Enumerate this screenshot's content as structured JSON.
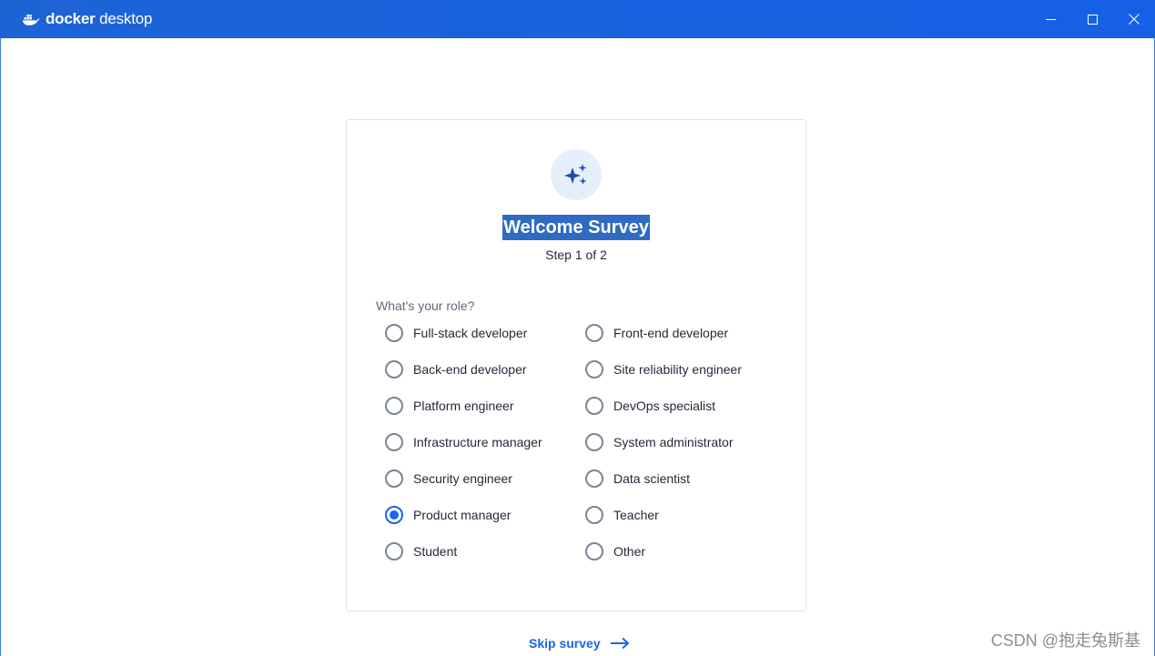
{
  "titlebar": {
    "app_name_bold": "docker",
    "app_name_light": " desktop",
    "minimize_icon": "minimize-icon",
    "maximize_icon": "maximize-icon",
    "close_icon": "close-icon"
  },
  "survey": {
    "icon": "sparkles-icon",
    "title": "Welcome Survey",
    "step": "Step 1 of 2",
    "question": "What's your role?",
    "options": [
      {
        "label": "Full-stack developer",
        "selected": false
      },
      {
        "label": "Front-end developer",
        "selected": false
      },
      {
        "label": "Back-end developer",
        "selected": false
      },
      {
        "label": "Site reliability engineer",
        "selected": false
      },
      {
        "label": "Platform engineer",
        "selected": false
      },
      {
        "label": "DevOps specialist",
        "selected": false
      },
      {
        "label": "Infrastructure manager",
        "selected": false
      },
      {
        "label": "System administrator",
        "selected": false
      },
      {
        "label": "Security engineer",
        "selected": false
      },
      {
        "label": "Data scientist",
        "selected": false
      },
      {
        "label": "Product manager",
        "selected": true
      },
      {
        "label": "Teacher",
        "selected": false
      },
      {
        "label": "Student",
        "selected": false
      },
      {
        "label": "Other",
        "selected": false
      }
    ],
    "skip_label": "Skip survey"
  },
  "watermark": "CSDN @抱走兔斯基",
  "colors": {
    "titlebar": "#1e63d6",
    "accent": "#1d63ed",
    "highlight": "#2f6bc3"
  }
}
